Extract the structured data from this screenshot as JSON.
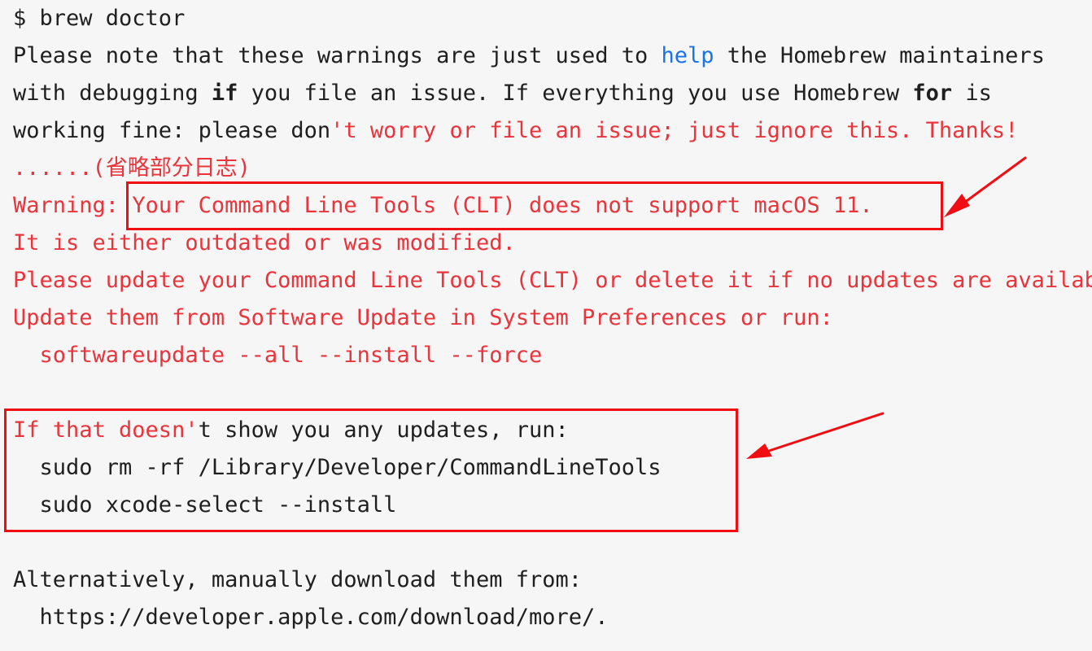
{
  "terminal": {
    "lines": [
      {
        "parts": [
          {
            "text": "$ brew doctor",
            "style": "normal"
          }
        ]
      },
      {
        "parts": [
          {
            "text": "Please note that these warnings are just used to ",
            "style": "normal"
          },
          {
            "text": "help",
            "style": "blue"
          },
          {
            "text": " the Homebrew maintainers",
            "style": "normal"
          }
        ]
      },
      {
        "parts": [
          {
            "text": "with debugging ",
            "style": "normal"
          },
          {
            "text": "if",
            "style": "bold"
          },
          {
            "text": " you file an issue. If everything you use Homebrew ",
            "style": "normal"
          },
          {
            "text": "for",
            "style": "bold"
          },
          {
            "text": " is",
            "style": "normal"
          }
        ]
      },
      {
        "parts": [
          {
            "text": "working fine: please don",
            "style": "normal"
          },
          {
            "text": "'t worry or file an issue; just ignore this. Thanks!",
            "style": "red"
          }
        ]
      },
      {
        "parts": [
          {
            "text": "......(省略部分日志)",
            "style": "red"
          }
        ]
      },
      {
        "parts": [
          {
            "text": "Warning: ",
            "style": "red"
          },
          {
            "text": "Your Command Line Tools (CLT) does not support macOS 11.",
            "style": "red"
          }
        ]
      },
      {
        "parts": [
          {
            "text": "It is either outdated or was modified.",
            "style": "red"
          }
        ]
      },
      {
        "parts": [
          {
            "text": "Please update your Command Line Tools (CLT) or delete it if no updates are available.",
            "style": "red"
          }
        ]
      },
      {
        "parts": [
          {
            "text": "Update them from Software Update in System Preferences or run:",
            "style": "red"
          }
        ]
      },
      {
        "parts": [
          {
            "text": "  softwareupdate --all --install --force",
            "style": "red"
          }
        ]
      },
      {
        "parts": [
          {
            "text": "",
            "style": "normal"
          }
        ]
      },
      {
        "parts": [
          {
            "text": "If that doesn'",
            "style": "red"
          },
          {
            "text": "t show you any updates, run:",
            "style": "normal"
          }
        ]
      },
      {
        "parts": [
          {
            "text": "  sudo rm -rf /Library/Developer/CommandLineTools",
            "style": "normal"
          }
        ]
      },
      {
        "parts": [
          {
            "text": "  sudo xcode-select --install",
            "style": "normal"
          }
        ]
      },
      {
        "parts": [
          {
            "text": "",
            "style": "normal"
          }
        ]
      },
      {
        "parts": [
          {
            "text": "Alternatively, manually download them from:",
            "style": "normal"
          }
        ]
      },
      {
        "parts": [
          {
            "text": "  https://developer.apple.com/download/more/.",
            "style": "normal"
          }
        ]
      }
    ]
  },
  "colors": {
    "background": "#f6f6f6",
    "text": "#1f1f1f",
    "error_text": "#e9343b",
    "keyword_blue": "#1a73e8",
    "annotation_red": "#f00e12"
  },
  "annotations": [
    {
      "type": "highlight-box",
      "target": "clt-warning"
    },
    {
      "type": "highlight-box",
      "target": "reinstall-commands"
    }
  ]
}
